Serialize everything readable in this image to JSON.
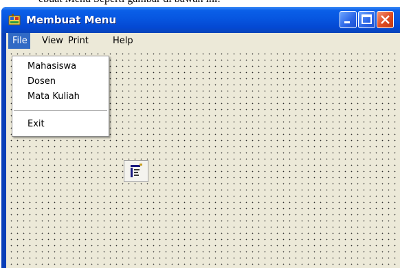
{
  "caption_fragment": "ebuat Menu Seperti gambar di bawah ini:",
  "window": {
    "title": "Membuat Menu",
    "controls": [
      "minimize-icon",
      "maximize-icon",
      "close-icon"
    ]
  },
  "menubar": {
    "items": [
      "File",
      "View",
      "Print",
      "Help"
    ],
    "active": "File"
  },
  "file_menu": {
    "items": [
      "Mahasiswa",
      "Dosen",
      "Mata Kuliah",
      "Exit"
    ]
  },
  "form_designer": {
    "control_icon": "menu-editor-icon"
  },
  "colors": {
    "titlebar": "#0756e0",
    "menu_highlight": "#316ac5",
    "form_background": "#ece9d8",
    "close_button": "#df4a21"
  }
}
